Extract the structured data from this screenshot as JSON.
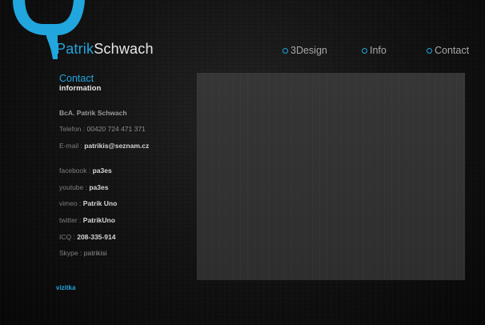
{
  "logo": {
    "first": "Patrik",
    "last": "Schwach",
    "brand_color": "#21a6de"
  },
  "nav": {
    "items": [
      {
        "label": "3Design"
      },
      {
        "label": "Info"
      },
      {
        "label": "Contact"
      }
    ]
  },
  "section": {
    "title": "Contact",
    "subtitle": "information"
  },
  "contact": {
    "name": "BcA. Patrik Schwach",
    "phone_label": "Telefon :",
    "phone_value": "00420 724 471 371",
    "email_label": "E-mail :",
    "email_value": "patrikis@seznam.cz",
    "facebook_label": "facebook :",
    "facebook_value": "pa3es",
    "youtube_label": "youtube :",
    "youtube_value": "pa3es",
    "vimeo_label": "vimeo :",
    "vimeo_value": "Patrik Uno",
    "twitter_label": "twitter :",
    "twitter_value": "PatrikUno",
    "icq_label": "ICQ :",
    "icq_value": "208-335-914",
    "skype_label": "Skype :",
    "skype_value": "patrikisi"
  },
  "footer": {
    "vizitka": "vizitka"
  }
}
